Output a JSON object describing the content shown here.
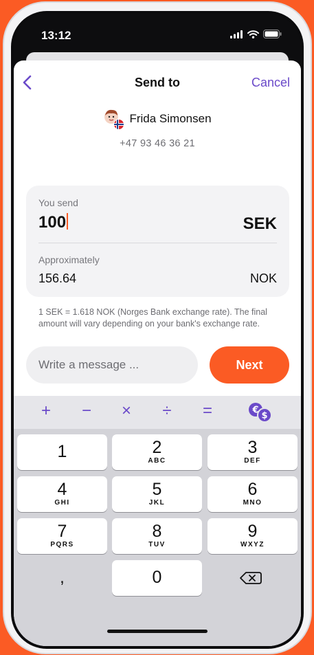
{
  "status_bar": {
    "time": "13:12"
  },
  "nav": {
    "title": "Send to",
    "cancel_label": "Cancel"
  },
  "recipient": {
    "name": "Frida Simonsen",
    "phone": "+47 93 46 36 21"
  },
  "amount": {
    "send_label": "You send",
    "send_value": "100",
    "send_currency": "SEK",
    "approx_label": "Approximately",
    "approx_value": "156.64",
    "approx_currency": "NOK"
  },
  "rate_text": "1 SEK = 1.618 NOK (Norges Bank exchange rate). The final amount will vary depending on your bank's exchange rate.",
  "message": {
    "placeholder": "Write a message ..."
  },
  "next_label": "Next",
  "operators": [
    "+",
    "−",
    "×",
    "÷",
    "="
  ],
  "keypad": {
    "k1": {
      "digit": "1",
      "letters": ""
    },
    "k2": {
      "digit": "2",
      "letters": "ABC"
    },
    "k3": {
      "digit": "3",
      "letters": "DEF"
    },
    "k4": {
      "digit": "4",
      "letters": "GHI"
    },
    "k5": {
      "digit": "5",
      "letters": "JKL"
    },
    "k6": {
      "digit": "6",
      "letters": "MNO"
    },
    "k7": {
      "digit": "7",
      "letters": "PQRS"
    },
    "k8": {
      "digit": "8",
      "letters": "TUV"
    },
    "k9": {
      "digit": "9",
      "letters": "WXYZ"
    },
    "k0": {
      "digit": "0",
      "letters": ""
    },
    "comma": ","
  },
  "colors": {
    "brand_orange": "#fb5b24",
    "accent_purple": "#6a49c9"
  },
  "icons": {
    "back": "chevron-left-icon",
    "currency_convert": "currency-exchange-icon",
    "delete": "backspace-icon"
  }
}
